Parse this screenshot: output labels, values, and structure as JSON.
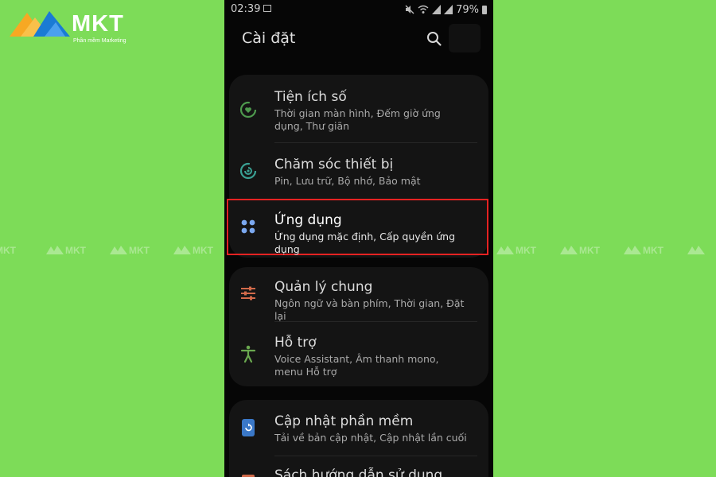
{
  "brand": {
    "name": "MKT",
    "tagline": "Phần mềm Marketing",
    "colors": {
      "orange": "#f7a823",
      "blue": "#1a7bd4",
      "background": "#7ddc58"
    }
  },
  "watermark": [
    "MKT",
    "MKT",
    "MKT",
    "MKT",
    "MKT",
    "MKT",
    "MKT",
    "MKT",
    "MKT",
    "MKT",
    "MKT"
  ],
  "status_bar": {
    "time": "02:39",
    "battery": "79%",
    "icons": [
      "image-icon",
      "mute-icon",
      "wifi-icon",
      "signal-icon",
      "signal-icon",
      "battery-icon"
    ]
  },
  "header": {
    "title": "Cài đặt",
    "search_icon": "search-icon"
  },
  "settings": [
    {
      "title": "Tiện ích số",
      "subtitle": "Thời gian màn hình, Đếm giờ ứng dụng, Thư giãn",
      "icon": "digital-wellbeing-icon",
      "color": "#4e9a4e"
    },
    {
      "title": "Chăm sóc thiết bị",
      "subtitle": "Pin, Lưu trữ, Bộ nhớ, Bảo mật",
      "icon": "device-care-icon",
      "color": "#3aa093"
    },
    {
      "title": "Ứng dụng",
      "subtitle": "Ứng dụng mặc định, Cấp quyền ứng dụng",
      "icon": "apps-icon",
      "color": "#7ba8ef",
      "highlighted": true
    },
    {
      "title": "Quản lý chung",
      "subtitle": "Ngôn ngữ và bàn phím, Thời gian, Đặt lại",
      "icon": "general-management-icon",
      "color": "#d16a4a"
    },
    {
      "title": "Hỗ trợ",
      "subtitle": "Voice Assistant, Âm thanh mono, menu Hỗ trợ",
      "icon": "accessibility-icon",
      "color": "#6aa84f"
    },
    {
      "title": "Cập nhật phần mềm",
      "subtitle": "Tải về bản cập nhật, Cập nhật lần cuối",
      "icon": "software-update-icon",
      "color": "#3a78c8"
    },
    {
      "title": "Sách hướng dẫn sử dụng",
      "subtitle": "",
      "icon": "user-manual-icon",
      "color": "#d16a4a"
    }
  ]
}
